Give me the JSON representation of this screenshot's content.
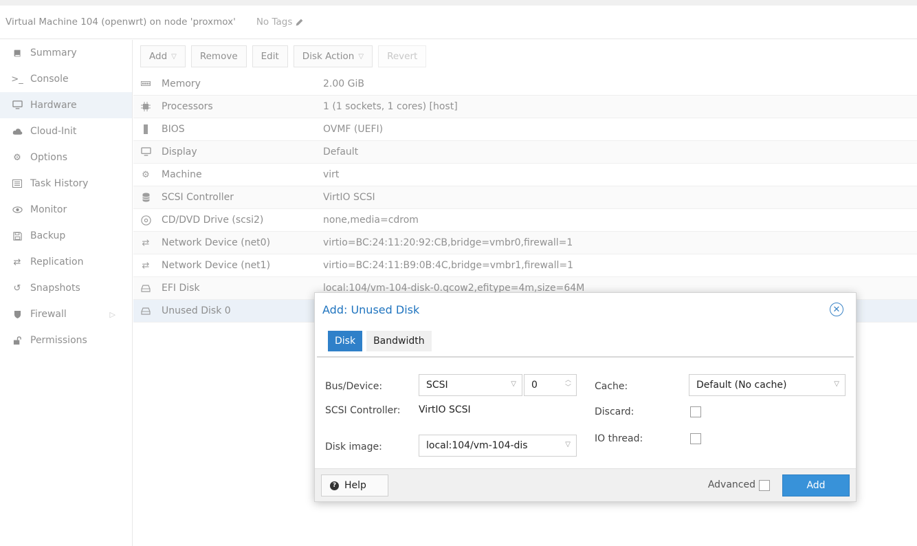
{
  "header": {
    "title": "Virtual Machine 104 (openwrt) on node 'proxmox'",
    "tags": "No Tags"
  },
  "sidebar": {
    "items": [
      {
        "label": "Summary",
        "icon": "book-icon"
      },
      {
        "label": "Console",
        "icon": "terminal-icon"
      },
      {
        "label": "Hardware",
        "icon": "desktop-icon"
      },
      {
        "label": "Cloud-Init",
        "icon": "cloud-icon"
      },
      {
        "label": "Options",
        "icon": "gear-icon"
      },
      {
        "label": "Task History",
        "icon": "list-icon"
      },
      {
        "label": "Monitor",
        "icon": "eye-icon"
      },
      {
        "label": "Backup",
        "icon": "floppy-icon"
      },
      {
        "label": "Replication",
        "icon": "retweet-icon"
      },
      {
        "label": "Snapshots",
        "icon": "history-icon"
      },
      {
        "label": "Firewall",
        "icon": "shield-icon"
      },
      {
        "label": "Permissions",
        "icon": "unlock-icon"
      }
    ]
  },
  "toolbar": {
    "add": "Add",
    "remove": "Remove",
    "edit": "Edit",
    "disk_action": "Disk Action",
    "revert": "Revert"
  },
  "hardware": [
    {
      "key": "Memory",
      "value": "2.00 GiB",
      "icon": "memory-icon"
    },
    {
      "key": "Processors",
      "value": "1 (1 sockets, 1 cores) [host]",
      "icon": "cpu-icon"
    },
    {
      "key": "BIOS",
      "value": "OVMF (UEFI)",
      "icon": "microchip-icon"
    },
    {
      "key": "Display",
      "value": "Default",
      "icon": "desktop-icon"
    },
    {
      "key": "Machine",
      "value": "virt",
      "icon": "cogs-icon"
    },
    {
      "key": "SCSI Controller",
      "value": "VirtIO SCSI",
      "icon": "database-icon"
    },
    {
      "key": "CD/DVD Drive (scsi2)",
      "value": "none,media=cdrom",
      "icon": "cdrom-icon"
    },
    {
      "key": "Network Device (net0)",
      "value": "virtio=BC:24:11:20:92:CB,bridge=vmbr0,firewall=1",
      "icon": "exchange-icon"
    },
    {
      "key": "Network Device (net1)",
      "value": "virtio=BC:24:11:B9:0B:4C,bridge=vmbr1,firewall=1",
      "icon": "exchange-icon"
    },
    {
      "key": "EFI Disk",
      "value": "local:104/vm-104-disk-0.qcow2,efitype=4m,size=64M",
      "icon": "hdd-icon"
    },
    {
      "key": "Unused Disk 0",
      "value": "",
      "icon": "hdd-icon"
    }
  ],
  "modal": {
    "title": "Add: Unused Disk",
    "tabs": {
      "disk": "Disk",
      "bandwidth": "Bandwidth"
    },
    "form": {
      "bus_label": "Bus/Device:",
      "bus_value": "SCSI",
      "device_value": "0",
      "controller_label": "SCSI Controller:",
      "controller_value": "VirtIO SCSI",
      "disk_image_label": "Disk image:",
      "disk_image_value": "local:104/vm-104-dis",
      "cache_label": "Cache:",
      "cache_value": "Default (No cache)",
      "discard_label": "Discard:",
      "io_thread_label": "IO thread:"
    },
    "footer": {
      "help": "Help",
      "advanced": "Advanced",
      "add": "Add"
    }
  },
  "colors": {
    "accent": "#2f80c9",
    "title": "#1f74bf",
    "add_button": "#3892d9"
  }
}
